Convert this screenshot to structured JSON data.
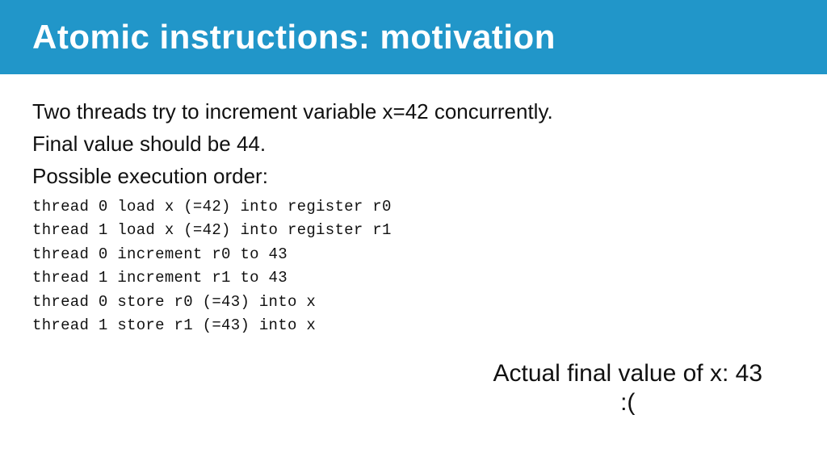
{
  "header": {
    "title": "Atomic instructions: motivation",
    "background_color": "#2196C9"
  },
  "content": {
    "intro_line1": "Two threads try to increment variable x=42  concurrently.",
    "intro_line2": "Final value should be 44.",
    "section_label": "Possible execution order:",
    "code_lines": [
      "thread 0 load x (=42) into register r0",
      "thread 1 load x (=42) into register r1",
      "thread 0 increment r0 to 43",
      "thread 1 increment r1 to 43",
      "thread 0 store r0 (=43) into x",
      "thread 1 store r1 (=43) into x"
    ],
    "actual_value_label": "Actual final value of x: 43",
    "sad_face": ":("
  }
}
